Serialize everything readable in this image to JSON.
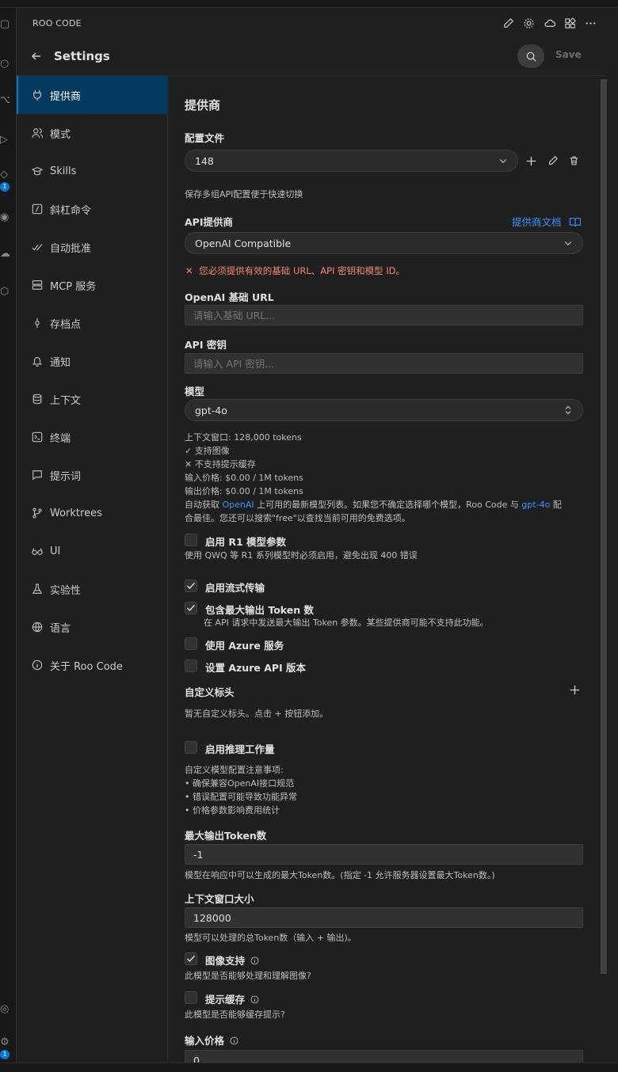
{
  "panel": {
    "header": "ROO CODE"
  },
  "settings": {
    "title": "Settings",
    "save_label": "Save"
  },
  "sidebar": {
    "items": [
      {
        "label": "提供商",
        "icon": "plug-icon"
      },
      {
        "label": "模式",
        "icon": "users-icon"
      },
      {
        "label": "Skills",
        "icon": "graduation-cap-icon"
      },
      {
        "label": "斜杠命令",
        "icon": "slash-square-icon"
      },
      {
        "label": "自动批准",
        "icon": "check-check-icon"
      },
      {
        "label": "MCP 服务",
        "icon": "server-icon"
      },
      {
        "label": "存档点",
        "icon": "git-commit-icon"
      },
      {
        "label": "通知",
        "icon": "bell-icon"
      },
      {
        "label": "上下文",
        "icon": "database-icon"
      },
      {
        "label": "终端",
        "icon": "terminal-icon"
      },
      {
        "label": "提示词",
        "icon": "message-icon"
      },
      {
        "label": "Worktrees",
        "icon": "git-branch-icon"
      },
      {
        "label": "UI",
        "icon": "glasses-icon"
      },
      {
        "label": "实验性",
        "icon": "flask-icon"
      },
      {
        "label": "语言",
        "icon": "globe-icon"
      },
      {
        "label": "关于 Roo Code",
        "icon": "info-icon"
      }
    ]
  },
  "activity": {
    "badge1": "1",
    "badge2": "1"
  },
  "provider": {
    "section_title": "提供商",
    "profile_label": "配置文件",
    "profile_value": "148",
    "profile_desc": "保存多组API配置便于快速切换",
    "api_provider_label": "API提供商",
    "provider_docs_link": "提供商文档",
    "api_provider_value": "OpenAI Compatible",
    "error_text": "您必须提供有效的基础 URL、API 密钥和模型 ID。",
    "base_url_label": "OpenAI 基础 URL",
    "base_url_placeholder": "请输入基础 URL...",
    "api_key_label": "API 密钥",
    "api_key_placeholder": "请输入 API 密钥...",
    "model_label": "模型",
    "model_value": "gpt-4o",
    "model_info": {
      "context_window_label": "上下文窗口:",
      "context_window_value": "128,000 tokens",
      "supports_images": "支持图像",
      "no_prompt_cache": "不支持提示缓存",
      "input_price_label": "输入价格:",
      "input_price_value": "$0.00 / 1M tokens",
      "output_price_label": "输出价格:",
      "output_price_value": "$0.00 / 1M tokens",
      "auto_fetch_pre": "自动获取 ",
      "auto_fetch_link1": "OpenAI",
      "auto_fetch_mid": " 上可用的最新模型列表。如果您不确定选择哪个模型，Roo Code 与 ",
      "auto_fetch_link2": "gpt-4o",
      "auto_fetch_post": " 配",
      "auto_fetch_line2": "合最佳。您还可以搜索\"free\"以查找当前可用的免费选项。"
    },
    "r1_label": "启用 R1 模型参数",
    "r1_desc": "使用 QWQ 等 R1 系列模型时必须启用，避免出现 400 错误",
    "streaming_label": "启用流式传输",
    "max_tokens_label": "包含最大输出 Token 数",
    "max_tokens_desc": "在 API 请求中发送最大输出 Token 参数。某些提供商可能不支持此功能。",
    "azure_label": "使用 Azure 服务",
    "azure_version_label": "设置 Azure API 版本",
    "custom_headers_label": "自定义标头",
    "custom_headers_desc": "暂无自定义标头。点击 + 按钮添加。",
    "reasoning_label": "启用推理工作量",
    "notes_title": "自定义模型配置注意事项:",
    "notes": [
      "• 确保兼容OpenAI接口规范",
      "• 错误配置可能导致功能异常",
      "• 价格参数影响费用统计"
    ],
    "max_output_label": "最大输出Token数",
    "max_output_value": "-1",
    "max_output_desc": "模型在响应中可以生成的最大Token数。(指定 -1 允许服务器设置最大Token数。)",
    "ctx_size_label": "上下文窗口大小",
    "ctx_size_value": "128000",
    "ctx_size_desc": "模型可以处理的总Token数（输入 + 输出)。",
    "image_support_label": "图像支持",
    "image_support_desc": "此模型是否能够处理和理解图像?",
    "prompt_cache_label": "提示缓存",
    "prompt_cache_desc": "此模型是否能够缓存提示?",
    "input_price_label": "输入价格",
    "input_price_value": "0"
  },
  "checkboxes": {
    "r1": false,
    "streaming": true,
    "max_tokens": true,
    "azure": false,
    "azure_version": false,
    "reasoning": false,
    "image_support": true,
    "prompt_cache": false
  },
  "colors": {
    "accent": "#0078d4",
    "active_bg": "#04395e",
    "error": "#f48771",
    "link": "#3794ff"
  }
}
